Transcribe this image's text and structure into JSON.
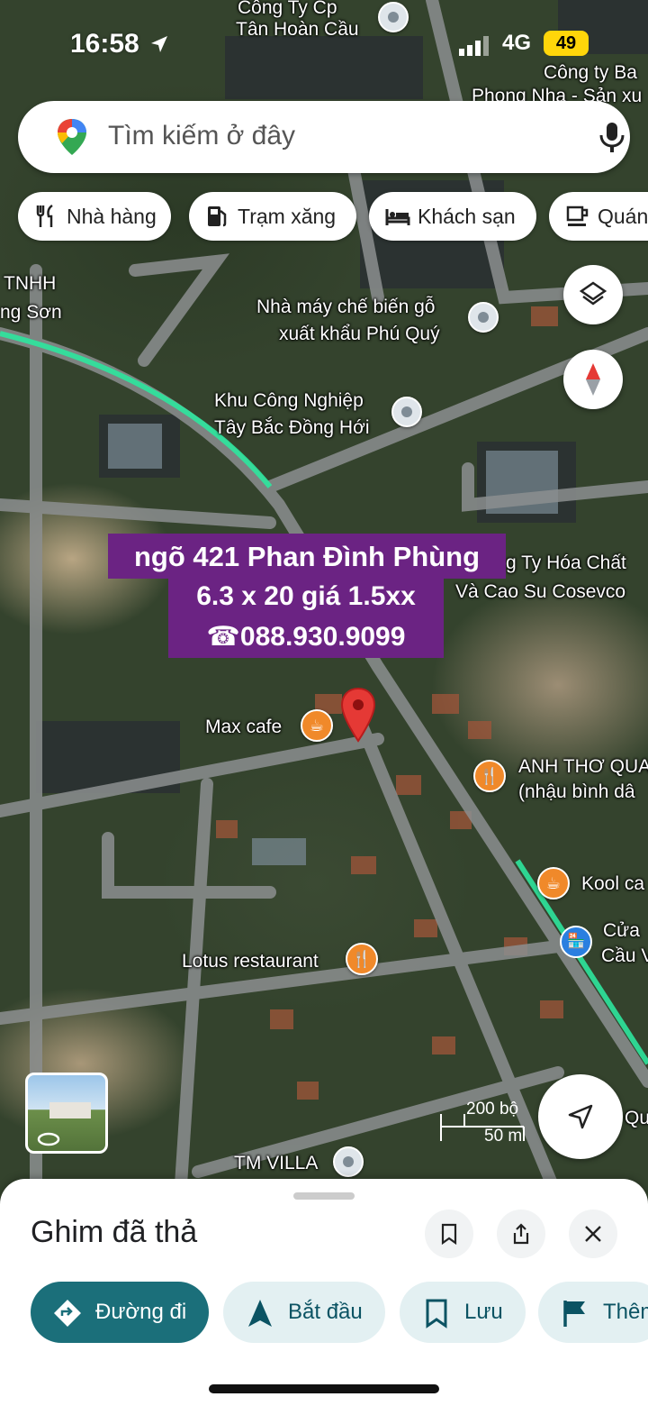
{
  "status_bar": {
    "time": "16:58",
    "network": "4G",
    "battery": "49"
  },
  "search": {
    "placeholder": "Tìm kiếm ở đây"
  },
  "chips": [
    {
      "label": "Nhà hàng",
      "icon": "restaurant-icon"
    },
    {
      "label": "Trạm xăng",
      "icon": "gas-station-icon"
    },
    {
      "label": "Khách sạn",
      "icon": "hotel-icon"
    },
    {
      "label": "Quán",
      "icon": "coffee-icon"
    }
  ],
  "map": {
    "labels": {
      "tan_hoan_cau_1": "Công Ty Cp",
      "tan_hoan_cau_2": "Tân Hoàn Cầu",
      "cong_ty_ba_1": "Công ty Ba",
      "cong_ty_ba_2": "Phong Nha - Sản xu",
      "tnhh_1": "TNHH",
      "tnhh_2": "ng Sơn",
      "phu_quy_1": "Nhà máy chế biến gỗ",
      "phu_quy_2": "xuất khẩu Phú Quý",
      "kcn_1": "Khu Công Nghiệp",
      "kcn_2": "Tây Bắc Đồng Hới",
      "cosevco_1": "g Ty Hóa Chất",
      "cosevco_2": "Và Cao Su Cosevco",
      "max_cafe": "Max cafe",
      "anh_tho_1": "ANH THƠ QUA",
      "anh_tho_2": "(nhậu bình dâ",
      "kool": "Kool ca",
      "cua_1": "Cửa",
      "cua_2": "Cầu V",
      "lotus": "Lotus restaurant",
      "tm_villa": "TM VILLA",
      "qu": "Qu"
    },
    "scale": {
      "imperial": "200 bộ",
      "metric": "50 m"
    }
  },
  "overlay": {
    "line1": "ngõ 421 Phan Đình Phùng",
    "line2": "6.3 x 20 giá 1.5xx",
    "line3": "☎088.930.9099"
  },
  "sheet": {
    "title": "Ghim đã thả",
    "actions": [
      {
        "label": "Đường đi",
        "icon": "directions-icon"
      },
      {
        "label": "Bắt đầu",
        "icon": "navigation-arrow-icon"
      },
      {
        "label": "Lưu",
        "icon": "bookmark-icon"
      },
      {
        "label": "Thêm",
        "icon": "flag-icon"
      }
    ]
  },
  "colors": {
    "overlay_bg": "#6b2383",
    "primary_action": "#1b6f7a",
    "secondary_action": "#e3f0f2",
    "pin": "#e53935",
    "route_green": "#2ee59d"
  }
}
